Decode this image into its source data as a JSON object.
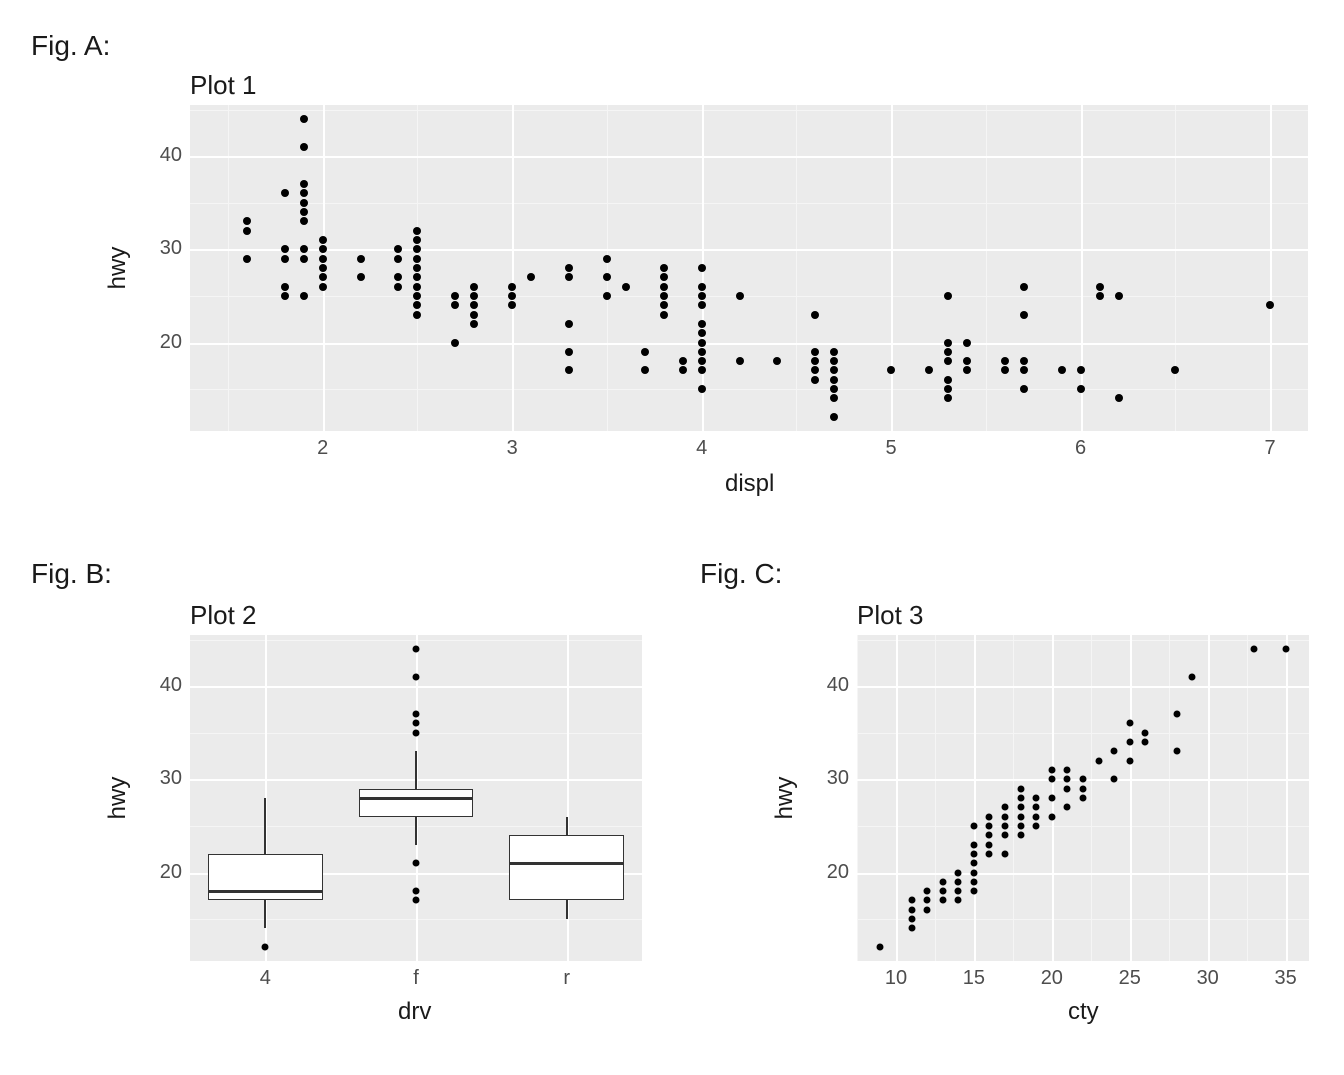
{
  "figA_label": "Fig. A:",
  "figB_label": "Fig. B:",
  "figC_label": "Fig. C:",
  "plot1": {
    "title": "Plot 1",
    "xlabel": "displ",
    "ylabel": "hwy",
    "xticks": [
      "2",
      "3",
      "4",
      "5",
      "6",
      "7"
    ],
    "yticks": [
      "20",
      "30",
      "40"
    ]
  },
  "plot2": {
    "title": "Plot 2",
    "xlabel": "drv",
    "ylabel": "hwy",
    "xticks": [
      "4",
      "f",
      "r"
    ],
    "yticks": [
      "20",
      "30",
      "40"
    ]
  },
  "plot3": {
    "title": "Plot 3",
    "xlabel": "cty",
    "ylabel": "hwy",
    "xticks": [
      "10",
      "15",
      "20",
      "25",
      "30",
      "35"
    ],
    "yticks": [
      "20",
      "30",
      "40"
    ]
  },
  "chart_data": [
    {
      "id": "plot1",
      "type": "scatter",
      "title": "Plot 1",
      "xlabel": "displ",
      "ylabel": "hwy",
      "xlim": [
        1.3,
        7.2
      ],
      "ylim": [
        10.5,
        45.5
      ],
      "points": [
        [
          1.6,
          33
        ],
        [
          1.6,
          32
        ],
        [
          1.6,
          29
        ],
        [
          1.8,
          36
        ],
        [
          1.8,
          30
        ],
        [
          1.8,
          29
        ],
        [
          1.8,
          26
        ],
        [
          1.8,
          25
        ],
        [
          1.9,
          44
        ],
        [
          1.9,
          41
        ],
        [
          1.9,
          37
        ],
        [
          1.9,
          36
        ],
        [
          1.9,
          35
        ],
        [
          1.9,
          34
        ],
        [
          1.9,
          33
        ],
        [
          1.9,
          30
        ],
        [
          1.9,
          29
        ],
        [
          1.9,
          25
        ],
        [
          2.0,
          31
        ],
        [
          2.0,
          30
        ],
        [
          2.0,
          29
        ],
        [
          2.0,
          28
        ],
        [
          2.0,
          27
        ],
        [
          2.0,
          26
        ],
        [
          2.2,
          27
        ],
        [
          2.2,
          29
        ],
        [
          2.4,
          30
        ],
        [
          2.4,
          29
        ],
        [
          2.4,
          27
        ],
        [
          2.4,
          26
        ],
        [
          2.5,
          32
        ],
        [
          2.5,
          31
        ],
        [
          2.5,
          30
        ],
        [
          2.5,
          29
        ],
        [
          2.5,
          28
        ],
        [
          2.5,
          27
        ],
        [
          2.5,
          26
        ],
        [
          2.5,
          25
        ],
        [
          2.5,
          24
        ],
        [
          2.5,
          23
        ],
        [
          2.7,
          25
        ],
        [
          2.7,
          24
        ],
        [
          2.7,
          20
        ],
        [
          2.8,
          26
        ],
        [
          2.8,
          25
        ],
        [
          2.8,
          24
        ],
        [
          2.8,
          23
        ],
        [
          2.8,
          22
        ],
        [
          3.0,
          26
        ],
        [
          3.0,
          25
        ],
        [
          3.0,
          24
        ],
        [
          3.1,
          27
        ],
        [
          3.3,
          28
        ],
        [
          3.3,
          27
        ],
        [
          3.3,
          22
        ],
        [
          3.3,
          19
        ],
        [
          3.3,
          17
        ],
        [
          3.5,
          29
        ],
        [
          3.5,
          27
        ],
        [
          3.5,
          25
        ],
        [
          3.6,
          26
        ],
        [
          3.7,
          19
        ],
        [
          3.7,
          17
        ],
        [
          3.8,
          28
        ],
        [
          3.8,
          27
        ],
        [
          3.8,
          26
        ],
        [
          3.8,
          25
        ],
        [
          3.8,
          24
        ],
        [
          3.8,
          23
        ],
        [
          3.9,
          18
        ],
        [
          3.9,
          17
        ],
        [
          4.0,
          28
        ],
        [
          4.0,
          26
        ],
        [
          4.0,
          25
        ],
        [
          4.0,
          24
        ],
        [
          4.0,
          22
        ],
        [
          4.0,
          21
        ],
        [
          4.0,
          20
        ],
        [
          4.0,
          19
        ],
        [
          4.0,
          18
        ],
        [
          4.0,
          17
        ],
        [
          4.0,
          15
        ],
        [
          4.2,
          25
        ],
        [
          4.2,
          18
        ],
        [
          4.4,
          18
        ],
        [
          4.6,
          23
        ],
        [
          4.6,
          19
        ],
        [
          4.6,
          18
        ],
        [
          4.6,
          17
        ],
        [
          4.6,
          16
        ],
        [
          4.7,
          19
        ],
        [
          4.7,
          18
        ],
        [
          4.7,
          17
        ],
        [
          4.7,
          16
        ],
        [
          4.7,
          15
        ],
        [
          4.7,
          14
        ],
        [
          4.7,
          12
        ],
        [
          5.0,
          17
        ],
        [
          5.2,
          17
        ],
        [
          5.3,
          25
        ],
        [
          5.3,
          20
        ],
        [
          5.3,
          19
        ],
        [
          5.3,
          18
        ],
        [
          5.3,
          16
        ],
        [
          5.3,
          15
        ],
        [
          5.3,
          14
        ],
        [
          5.4,
          20
        ],
        [
          5.4,
          18
        ],
        [
          5.4,
          17
        ],
        [
          5.6,
          18
        ],
        [
          5.6,
          17
        ],
        [
          5.7,
          26
        ],
        [
          5.7,
          23
        ],
        [
          5.7,
          18
        ],
        [
          5.7,
          17
        ],
        [
          5.7,
          15
        ],
        [
          5.9,
          17
        ],
        [
          6.0,
          17
        ],
        [
          6.0,
          15
        ],
        [
          6.1,
          26
        ],
        [
          6.1,
          25
        ],
        [
          6.2,
          25
        ],
        [
          6.2,
          14
        ],
        [
          6.5,
          17
        ],
        [
          7.0,
          24
        ]
      ]
    },
    {
      "id": "plot2",
      "type": "boxplot",
      "title": "Plot 2",
      "xlabel": "drv",
      "ylabel": "hwy",
      "ylim": [
        10.5,
        45.5
      ],
      "categories": [
        "4",
        "f",
        "r"
      ],
      "boxes": [
        {
          "category": "4",
          "min": 14,
          "q1": 17,
          "median": 18,
          "q3": 22,
          "max": 28,
          "outliers": [
            12
          ]
        },
        {
          "category": "f",
          "min": 23,
          "q1": 26,
          "median": 28,
          "q3": 29,
          "max": 33,
          "outliers": [
            17,
            18,
            21,
            35,
            36,
            37,
            41,
            44
          ]
        },
        {
          "category": "r",
          "min": 15,
          "q1": 17,
          "median": 21,
          "q3": 24,
          "max": 26,
          "outliers": []
        }
      ]
    },
    {
      "id": "plot3",
      "type": "scatter",
      "title": "Plot 3",
      "xlabel": "cty",
      "ylabel": "hwy",
      "xlim": [
        7.5,
        36.5
      ],
      "ylim": [
        10.5,
        45.5
      ],
      "points": [
        [
          9,
          12
        ],
        [
          11,
          14
        ],
        [
          11,
          15
        ],
        [
          11,
          16
        ],
        [
          11,
          17
        ],
        [
          12,
          16
        ],
        [
          12,
          17
        ],
        [
          12,
          18
        ],
        [
          13,
          17
        ],
        [
          13,
          18
        ],
        [
          13,
          19
        ],
        [
          14,
          17
        ],
        [
          14,
          18
        ],
        [
          14,
          19
        ],
        [
          14,
          20
        ],
        [
          15,
          18
        ],
        [
          15,
          19
        ],
        [
          15,
          20
        ],
        [
          15,
          21
        ],
        [
          15,
          22
        ],
        [
          15,
          23
        ],
        [
          15,
          25
        ],
        [
          16,
          22
        ],
        [
          16,
          23
        ],
        [
          16,
          24
        ],
        [
          16,
          25
        ],
        [
          16,
          26
        ],
        [
          17,
          22
        ],
        [
          17,
          24
        ],
        [
          17,
          25
        ],
        [
          17,
          26
        ],
        [
          17,
          27
        ],
        [
          18,
          24
        ],
        [
          18,
          25
        ],
        [
          18,
          26
        ],
        [
          18,
          27
        ],
        [
          18,
          28
        ],
        [
          18,
          29
        ],
        [
          19,
          25
        ],
        [
          19,
          26
        ],
        [
          19,
          27
        ],
        [
          19,
          28
        ],
        [
          20,
          26
        ],
        [
          20,
          28
        ],
        [
          20,
          30
        ],
        [
          20,
          31
        ],
        [
          21,
          27
        ],
        [
          21,
          29
        ],
        [
          21,
          30
        ],
        [
          21,
          31
        ],
        [
          22,
          28
        ],
        [
          22,
          29
        ],
        [
          22,
          30
        ],
        [
          23,
          32
        ],
        [
          24,
          30
        ],
        [
          24,
          33
        ],
        [
          25,
          32
        ],
        [
          25,
          34
        ],
        [
          25,
          36
        ],
        [
          26,
          34
        ],
        [
          26,
          35
        ],
        [
          28,
          33
        ],
        [
          28,
          37
        ],
        [
          29,
          41
        ],
        [
          33,
          44
        ],
        [
          35,
          44
        ]
      ]
    }
  ]
}
